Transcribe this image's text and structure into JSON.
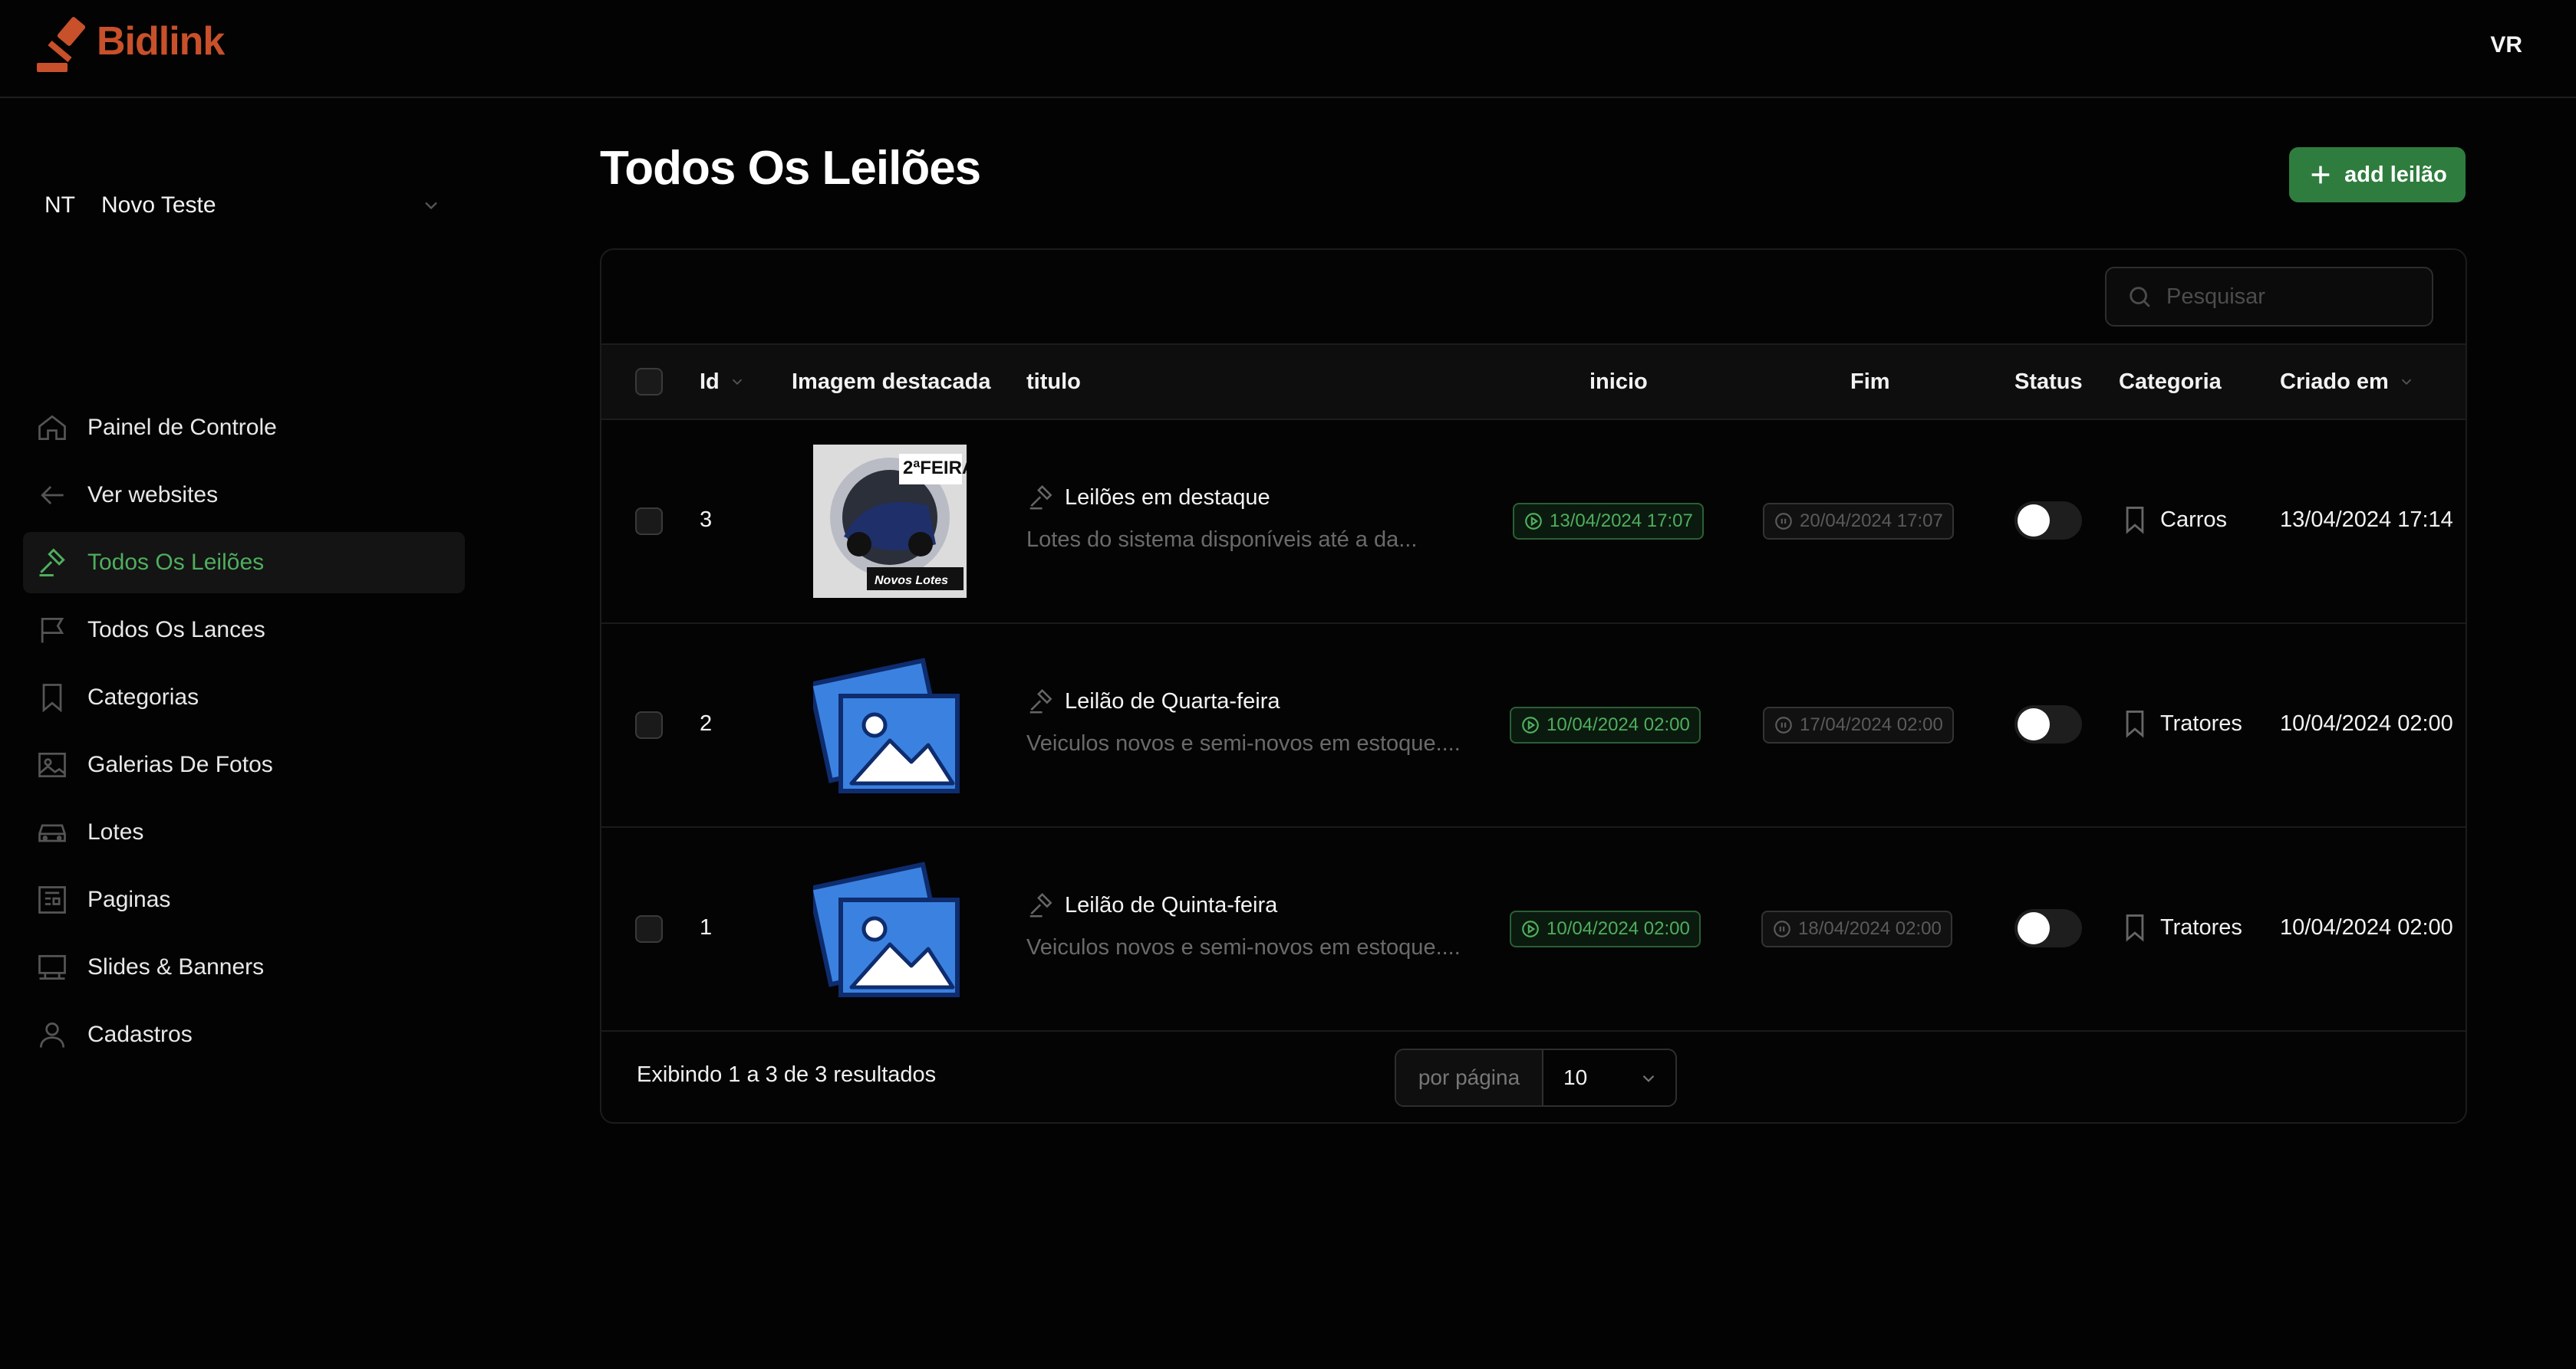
{
  "app": {
    "brand": "Bidlink",
    "user_initials": "VR",
    "colors": {
      "brand": "#c8502a",
      "accent": "#4fae5e",
      "primary_button": "#2e7d3e",
      "background": "#030303"
    }
  },
  "team": {
    "initials": "NT",
    "name": "Novo Teste"
  },
  "sidebar": {
    "items": [
      {
        "label": "Painel de Controle",
        "icon": "home-icon"
      },
      {
        "label": "Ver websites",
        "icon": "arrow-left-icon"
      },
      {
        "label": "Todos Os Leilões",
        "icon": "gavel-icon",
        "active": true
      },
      {
        "label": "Todos Os Lances",
        "icon": "flag-icon"
      },
      {
        "label": "Categorias",
        "icon": "bookmark-icon"
      },
      {
        "label": "Galerias De Fotos",
        "icon": "image-icon"
      },
      {
        "label": "Lotes",
        "icon": "car-icon"
      },
      {
        "label": "Paginas",
        "icon": "newspaper-icon"
      },
      {
        "label": "Slides & Banners",
        "icon": "slides-icon"
      },
      {
        "label": "Cadastros",
        "icon": "user-icon"
      }
    ]
  },
  "main": {
    "title": "Todos Os Leilões",
    "add_button": "add leilão"
  },
  "table": {
    "search_placeholder": "Pesquisar",
    "columns": {
      "id": "Id",
      "image": "Imagem destacada",
      "title": "titulo",
      "start": "inicio",
      "end": "Fim",
      "status": "Status",
      "category": "Categoria",
      "created": "Criado em"
    },
    "rows": [
      {
        "id": "3",
        "image": "feira-thumbnail",
        "title": "Leilões em destaque",
        "description": "Lotes do sistema disponíveis até a da...",
        "start": "13/04/2024 17:07",
        "end": "20/04/2024 17:07",
        "status_on": false,
        "category": "Carros",
        "created": "13/04/2024 17:14"
      },
      {
        "id": "2",
        "image": "image-placeholder-icon",
        "title": "Leilão de Quarta-feira",
        "description": "Veiculos novos e semi-novos em estoque....",
        "start": "10/04/2024 02:00",
        "end": "17/04/2024 02:00",
        "status_on": false,
        "category": "Tratores",
        "created": "10/04/2024 02:00"
      },
      {
        "id": "1",
        "image": "image-placeholder-icon",
        "title": "Leilão de Quinta-feira",
        "description": "Veiculos novos e semi-novos em estoque....",
        "start": "10/04/2024 02:00",
        "end": "18/04/2024 02:00",
        "status_on": false,
        "category": "Tratores",
        "created": "10/04/2024 02:00"
      }
    ],
    "footer": {
      "summary": "Exibindo 1 a 3 de 3 resultados",
      "per_page_label": "por página",
      "per_page_value": "10"
    }
  }
}
